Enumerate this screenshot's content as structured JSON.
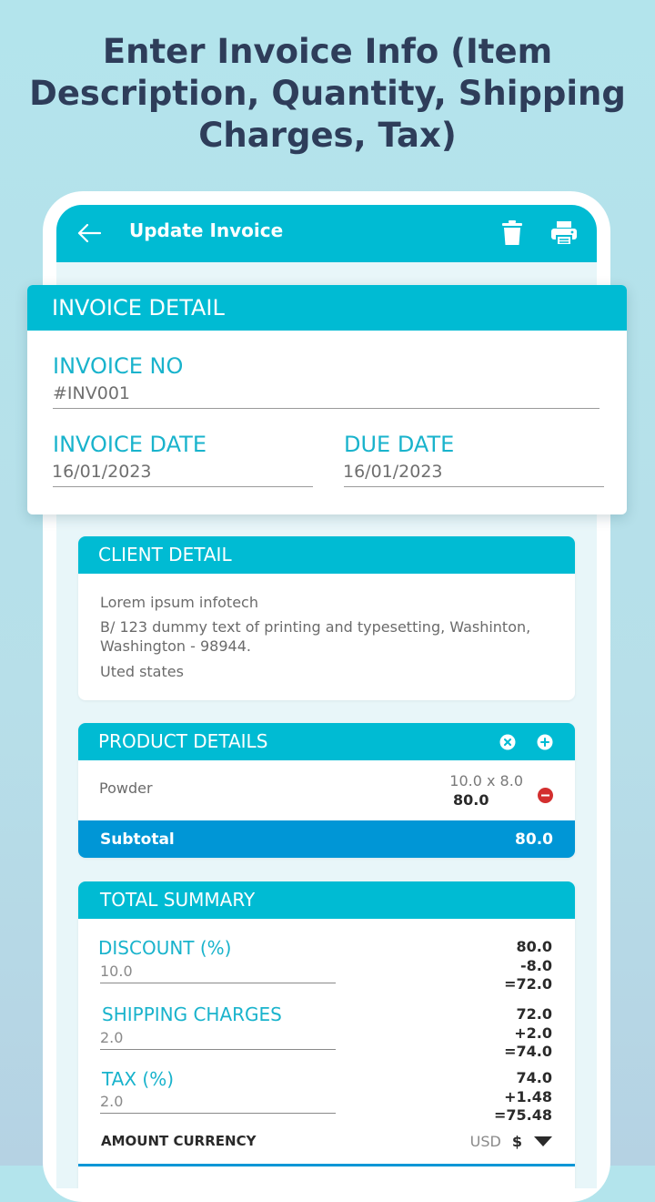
{
  "promo": {
    "line1": "Enter Invoice Info (Item",
    "line2": "Description, Quantity, Shipping",
    "line3": "Charges, Tax)"
  },
  "appbar": {
    "title": "Update Invoice"
  },
  "invoice_detail": {
    "header": "INVOICE DETAIL",
    "invoice_no_label": "INVOICE NO",
    "invoice_no_value": "#INV001",
    "invoice_date_label": "INVOICE DATE",
    "invoice_date_value": "16/01/2023",
    "due_date_label": "DUE DATE",
    "due_date_value": "16/01/2023"
  },
  "client_detail": {
    "header": "CLIENT DETAIL",
    "name": "Lorem ipsum infotech",
    "address_line1": "B/ 123 dummy text of printing and typesetting, Washinton,",
    "address_line2": "Washington - 98944.",
    "country": "Uted states"
  },
  "product_details": {
    "header": "PRODUCT DETAILS",
    "items": [
      {
        "name": "Powder",
        "qty_price": "10.0 x 8.0",
        "total": "80.0"
      }
    ],
    "subtotal_label": "Subtotal",
    "subtotal_value": "80.0"
  },
  "total_summary": {
    "header": "TOTAL SUMMARY",
    "discount_label": "DISCOUNT (%)",
    "discount_value": "10.0",
    "discount_calc": [
      "80.0",
      "-8.0",
      "=72.0"
    ],
    "shipping_label": "SHIPPING CHARGES",
    "shipping_value": "2.0",
    "shipping_calc": [
      "72.0",
      "+2.0",
      "=74.0"
    ],
    "tax_label": "TAX (%)",
    "tax_value": "2.0",
    "tax_calc": [
      "74.0",
      "+1.48",
      "=75.48"
    ],
    "currency_label": "AMOUNT CURRENCY",
    "currency_code": "USD",
    "currency_symbol": "$"
  },
  "colors": {
    "accent": "#00bbd3",
    "subtotal_bar": "#0096d6",
    "title": "#2e3d5a",
    "remove": "#d32f2f"
  }
}
